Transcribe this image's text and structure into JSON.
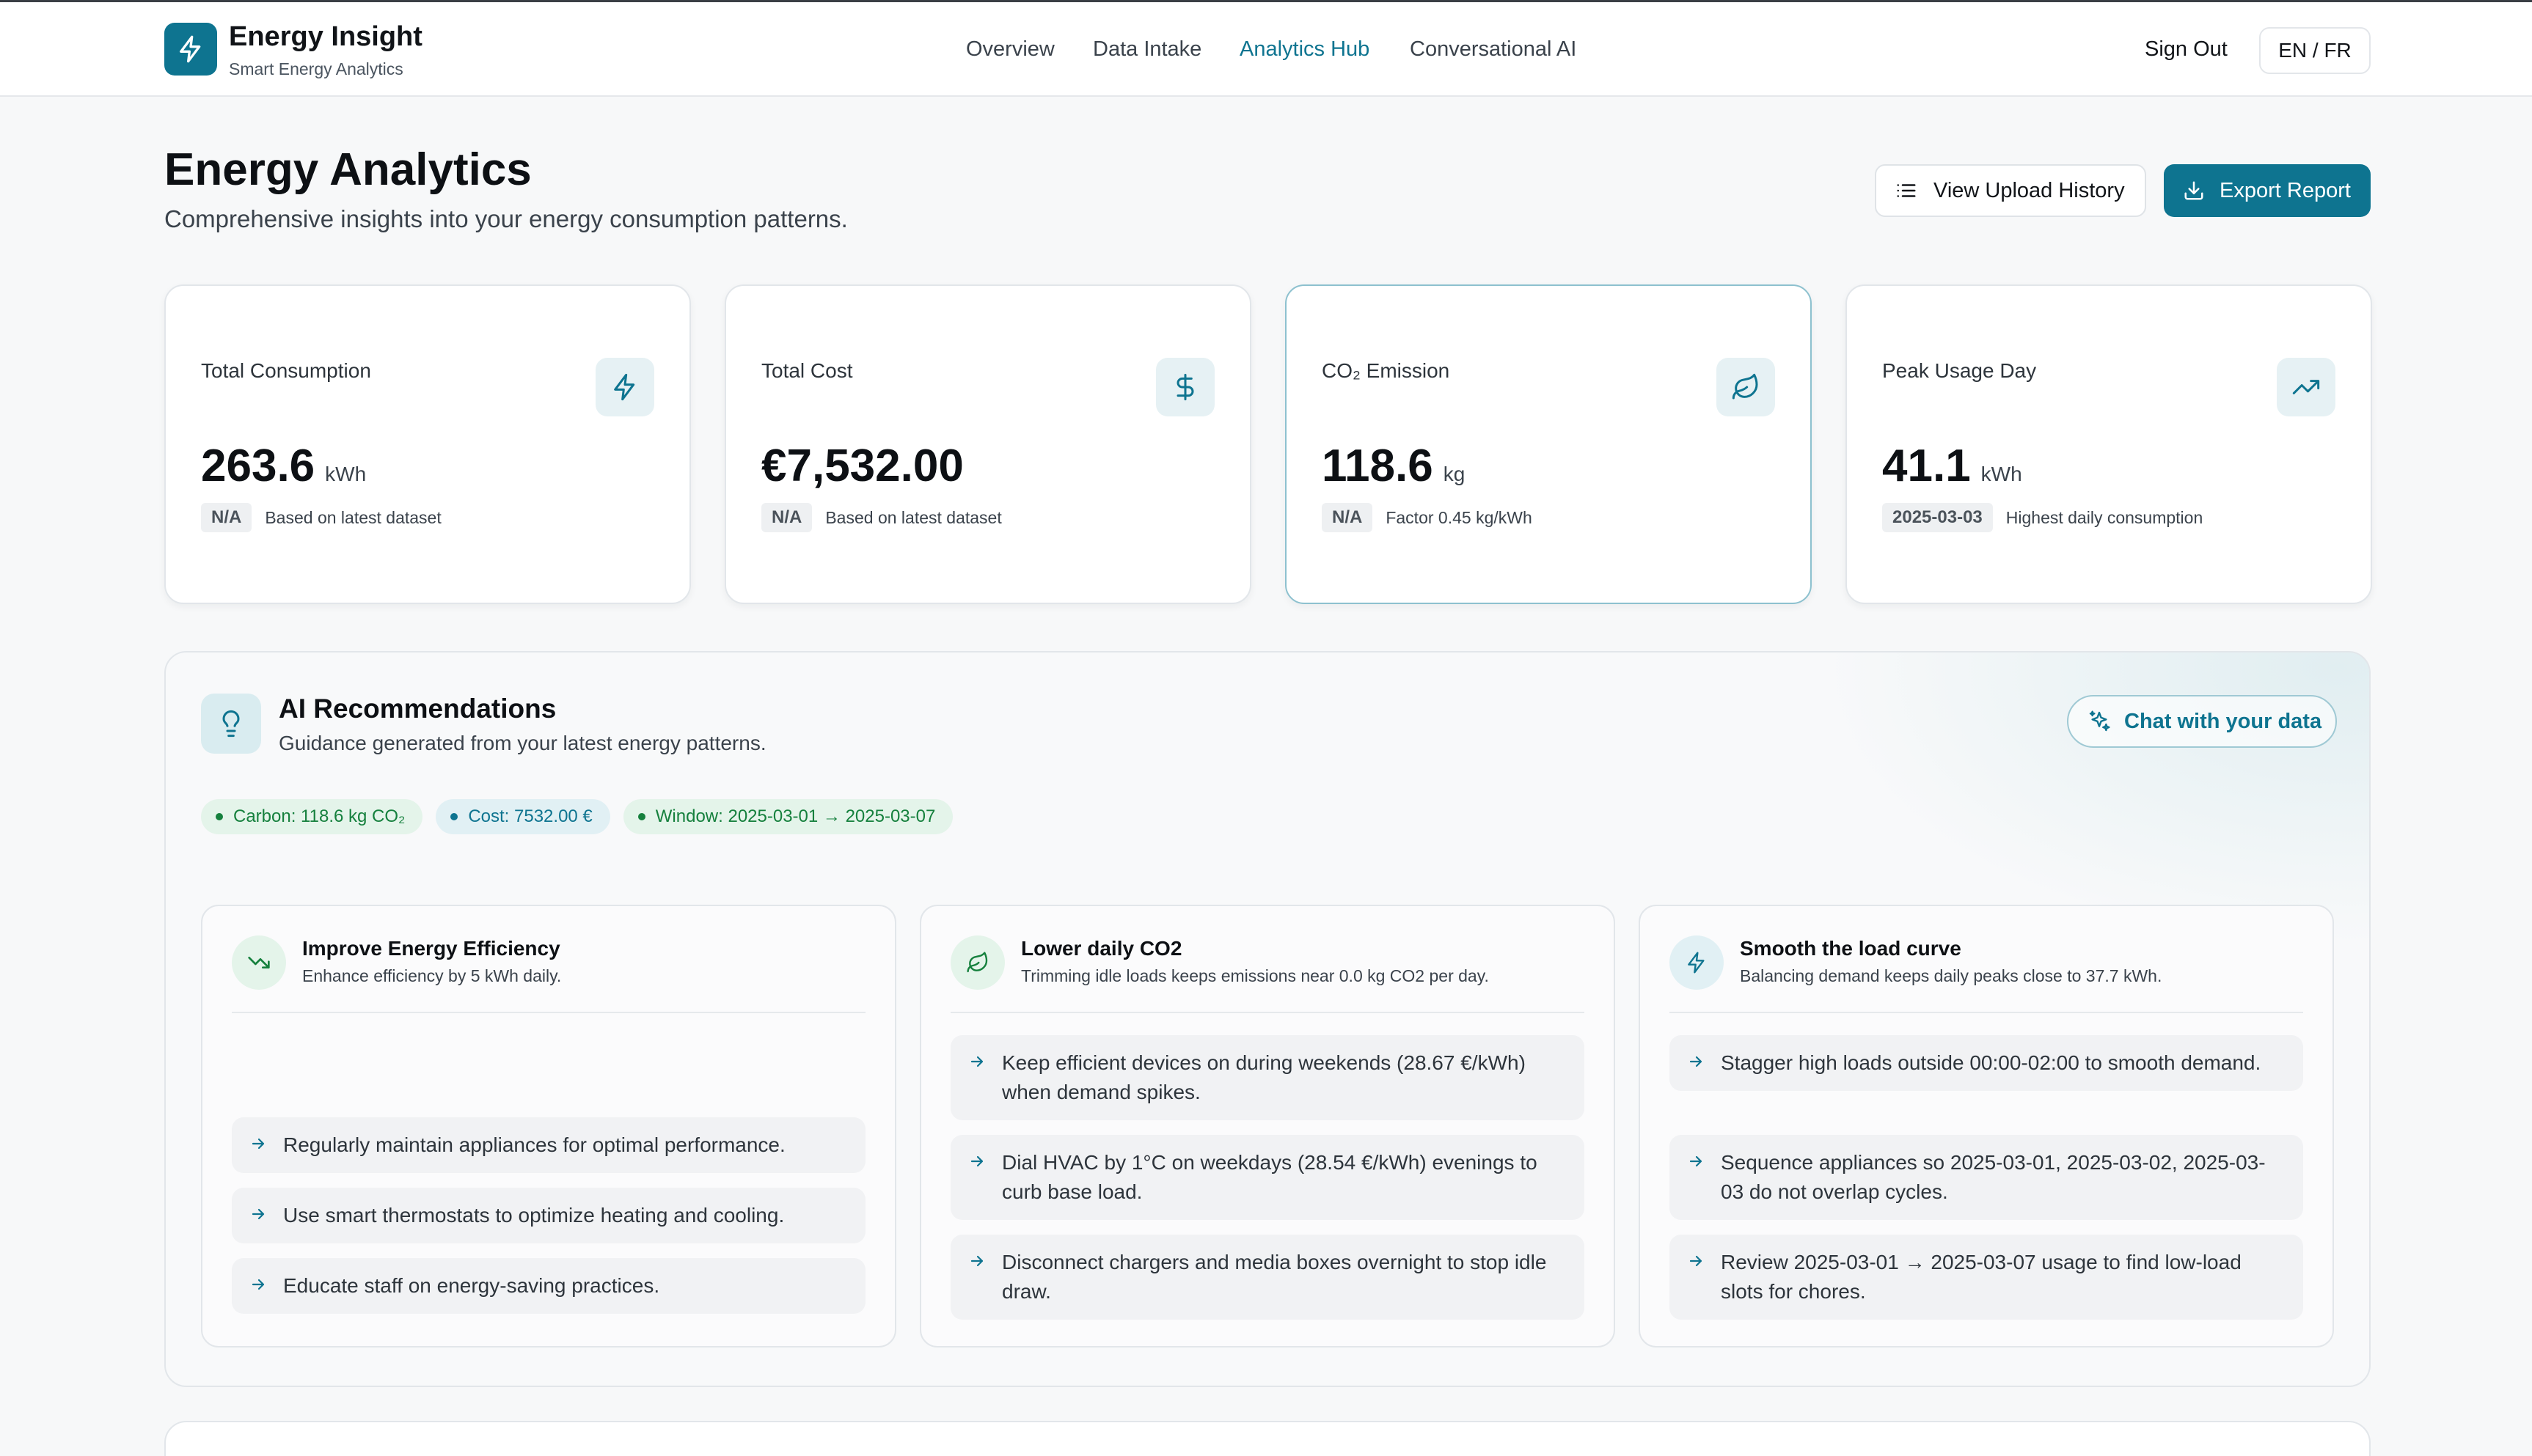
{
  "header": {
    "brand": "Energy Insight",
    "tagline": "Smart Energy Analytics",
    "nav": [
      "Overview",
      "Data Intake",
      "Analytics Hub",
      "Conversational AI"
    ],
    "active_nav": "Analytics Hub",
    "sign_out": "Sign Out",
    "language": "EN / FR"
  },
  "page": {
    "title": "Energy Analytics",
    "subtitle": "Comprehensive insights into your energy consumption patterns.",
    "upload_history_label": "View Upload History",
    "export_label": "Export Report"
  },
  "stats": [
    {
      "label": "Total Consumption",
      "value": "263.6",
      "unit": "kWh",
      "badge": "N/A",
      "note": "Based on latest dataset",
      "icon": "bolt-icon"
    },
    {
      "label": "Total Cost",
      "value": "€7,532.00",
      "unit": "",
      "badge": "N/A",
      "note": "Based on latest dataset",
      "icon": "dollar-icon"
    },
    {
      "label": "CO₂ Emission",
      "value": "118.6",
      "unit": "kg",
      "badge": "N/A",
      "note": "Factor 0.45 kg/kWh",
      "icon": "leaf-icon"
    },
    {
      "label": "Peak Usage Day",
      "value": "41.1",
      "unit": "kWh",
      "badge": "2025-03-03",
      "note": "Highest daily consumption",
      "icon": "trending-up-icon"
    }
  ],
  "ai": {
    "title": "AI Recommendations",
    "subtitle": "Guidance generated from your latest energy patterns.",
    "chat_label": "Chat with your data",
    "tags": [
      {
        "text": "Carbon: 118.6 kg CO₂",
        "color": "#15803d"
      },
      {
        "text": "Cost: 7532.00 €",
        "color": "#0e7490"
      },
      {
        "text": "Window: 2025-03-01 → 2025-03-07",
        "color": "#15803d"
      }
    ],
    "cards": [
      {
        "title": "Improve Energy Efficiency",
        "subtitle": "Enhance efficiency by 5 kWh daily.",
        "icon": "trending-down-icon",
        "items": [
          "Regularly maintain appliances for optimal performance.",
          "Use smart thermostats to optimize heating and cooling.",
          "Educate staff on energy-saving practices."
        ]
      },
      {
        "title": "Lower daily CO2",
        "subtitle": "Trimming idle loads keeps emissions near 0.0 kg CO2 per day.",
        "icon": "leaf-icon",
        "items": [
          "Keep efficient devices on during weekends (28.67 €/kWh) when demand spikes.",
          "Dial HVAC by 1°C on weekdays (28.54 €/kWh) evenings to curb base load.",
          "Disconnect chargers and media boxes overnight to stop idle draw."
        ]
      },
      {
        "title": "Smooth the load curve",
        "subtitle": "Balancing demand keeps daily peaks close to 37.7 kWh.",
        "icon": "bolt-icon",
        "items": [
          "Stagger high loads outside 00:00-02:00 to smooth demand.",
          "Sequence appliances so 2025-03-01, 2025-03-02, 2025-03-03 do not overlap cycles.",
          "Review 2025-03-01 → 2025-03-07 usage to find low-load slots for chores."
        ]
      }
    ]
  },
  "colors": {
    "accent": "#0e7490",
    "green": "#15803d",
    "background": "#f7f8f9"
  }
}
